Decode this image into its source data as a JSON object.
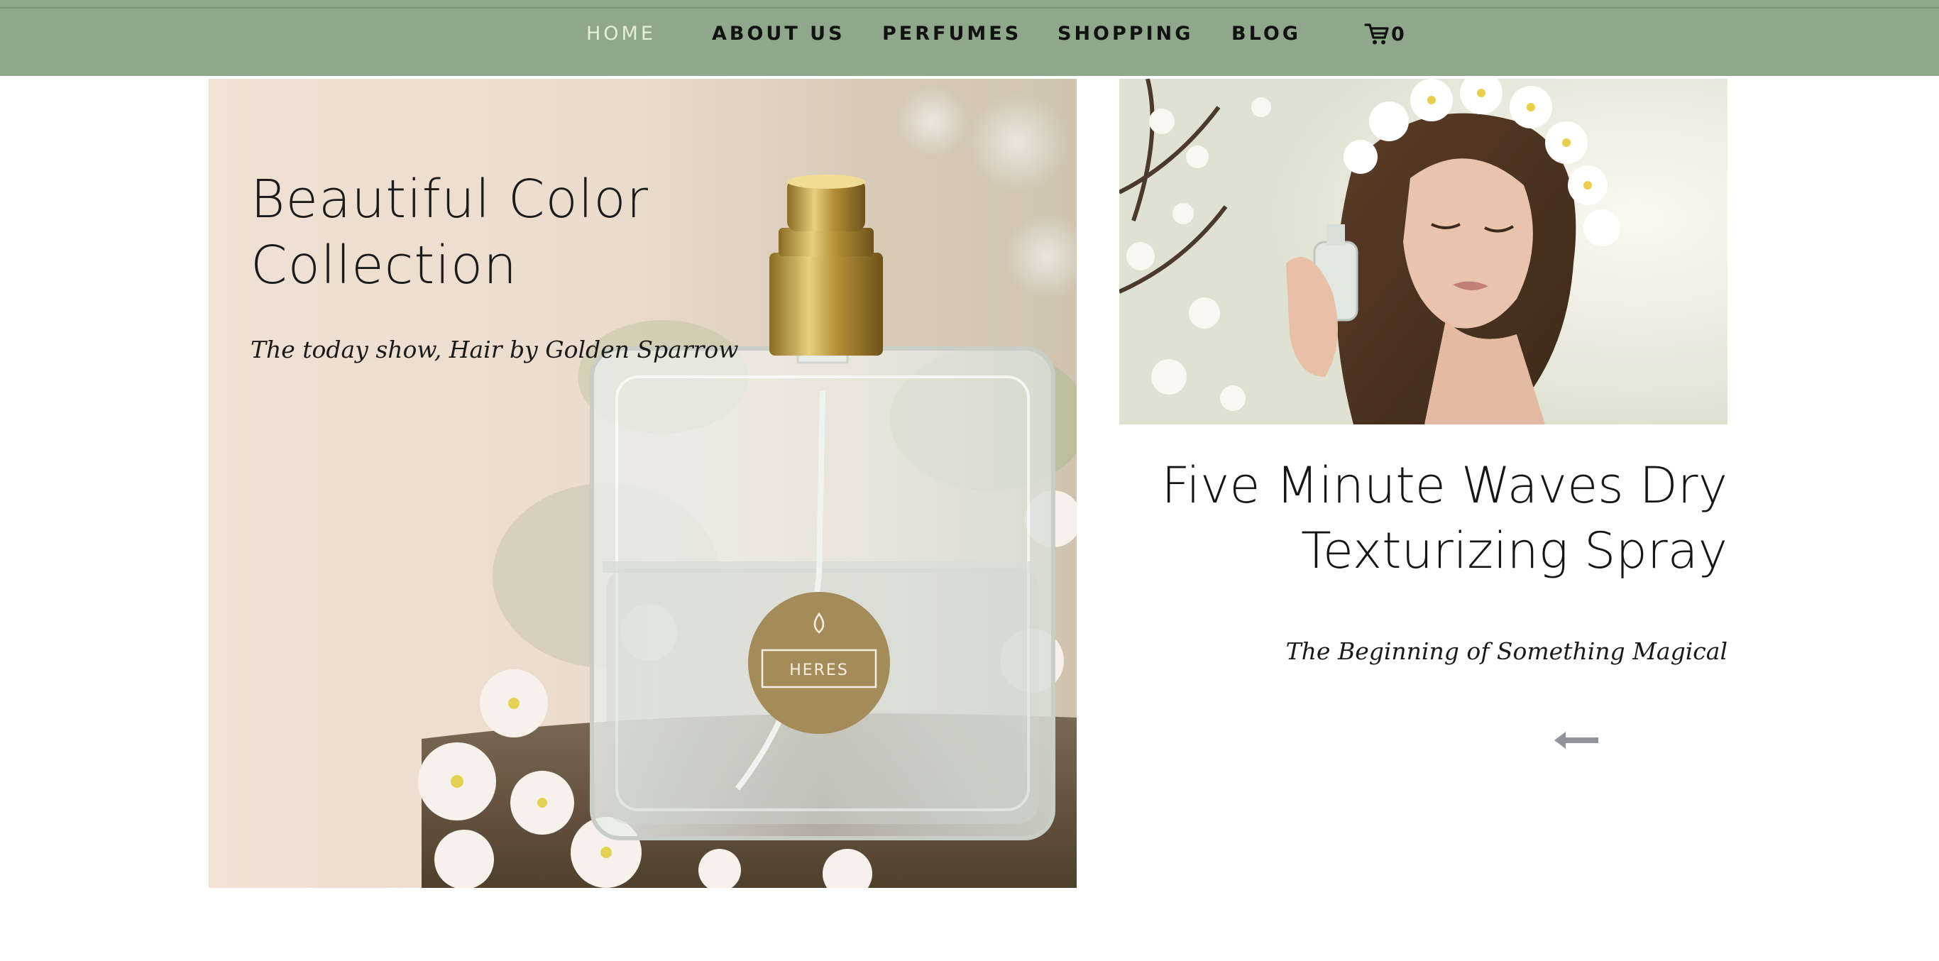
{
  "nav": {
    "items": [
      {
        "label": "HOME",
        "active": true
      },
      {
        "label": "ABOUT US",
        "active": false
      },
      {
        "label": "PERFUMES",
        "active": false
      },
      {
        "label": "SHOPPING",
        "active": false
      },
      {
        "label": "BLOG",
        "active": false
      }
    ],
    "cart": {
      "icon": "cart-icon",
      "count": "0"
    }
  },
  "hero": {
    "title_line1": "Beautiful Color",
    "title_line2": "Collection",
    "subtitle": "The today show, Hair by Golden Sparrow",
    "bottle_label": "HERES"
  },
  "feature": {
    "title_line1": "Five Minute Waves Dry",
    "title_line2": "Texturizing Spray",
    "subtitle": "The Beginning of Something Magical",
    "arrow_icon": "arrow-left-icon"
  },
  "colors": {
    "nav_bg": "#8fa78a",
    "nav_active": "#e4f0d4",
    "hero_bg": "#efe1d3"
  }
}
